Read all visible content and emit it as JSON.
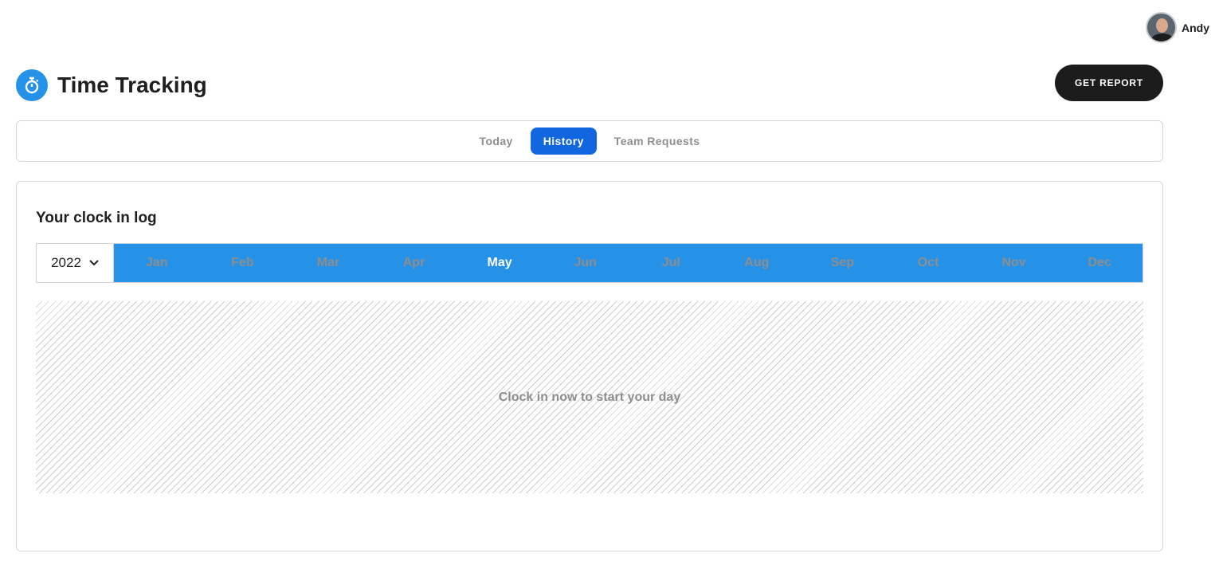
{
  "user": {
    "name": "Andy"
  },
  "header": {
    "title": "Time Tracking",
    "report_button": "GET REPORT"
  },
  "tabs": [
    {
      "label": "Today"
    },
    {
      "label": "History",
      "active": true
    },
    {
      "label": "Team Requests"
    }
  ],
  "log": {
    "title": "Your clock in log",
    "year": "2022",
    "selected_month": "May",
    "months": [
      "Jan",
      "Feb",
      "Mar",
      "Apr",
      "May",
      "Jun",
      "Jul",
      "Aug",
      "Sep",
      "Oct",
      "Nov",
      "Dec"
    ],
    "empty_message": "Clock in now to start your day"
  }
}
